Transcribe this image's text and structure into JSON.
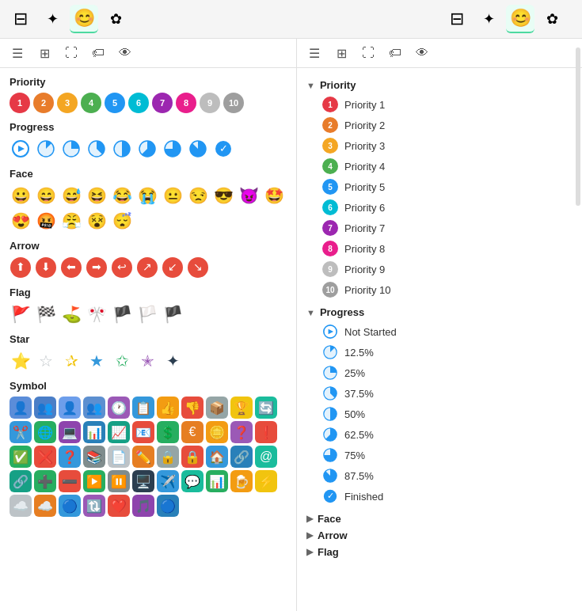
{
  "toolbar": {
    "icons": [
      {
        "name": "square-icon",
        "glyph": "⊟",
        "active": false
      },
      {
        "name": "sparkle-icon",
        "glyph": "✦",
        "active": false
      },
      {
        "name": "smiley-icon",
        "glyph": "😊",
        "active": true,
        "panel": "left"
      },
      {
        "name": "star-outline-icon",
        "glyph": "✿",
        "active": false
      },
      {
        "name": "square2-icon",
        "glyph": "⊟",
        "active": false
      },
      {
        "name": "sparkle2-icon",
        "glyph": "✦",
        "active": false
      },
      {
        "name": "smiley2-icon",
        "glyph": "😊",
        "active": true,
        "panel": "right"
      },
      {
        "name": "star-outline2-icon",
        "glyph": "✿",
        "active": false
      }
    ]
  },
  "left_subtoolbar": [
    "list",
    "grid",
    "expand",
    "tag",
    "eye"
  ],
  "right_subtoolbar": [
    "list",
    "grid",
    "expand",
    "tag",
    "eye"
  ],
  "priority": {
    "label": "Priority",
    "items": [
      {
        "num": 1,
        "color": "#e63946"
      },
      {
        "num": 2,
        "color": "#e87c2b"
      },
      {
        "num": 3,
        "color": "#f4a623"
      },
      {
        "num": 4,
        "color": "#4caf50"
      },
      {
        "num": 5,
        "color": "#2196f3"
      },
      {
        "num": 6,
        "color": "#00bcd4"
      },
      {
        "num": 7,
        "color": "#9c27b0"
      },
      {
        "num": 8,
        "color": "#e91e8c"
      },
      {
        "num": 9,
        "color": "#bdbdbd"
      },
      {
        "num": 10,
        "color": "#9e9e9e"
      }
    ]
  },
  "progress": {
    "label": "Progress",
    "items": [
      {
        "label": "Not Started",
        "type": "empty"
      },
      {
        "label": "12.5%",
        "type": "pie",
        "pct": 12.5
      },
      {
        "label": "25%",
        "type": "pie",
        "pct": 25
      },
      {
        "label": "37.5%",
        "type": "pie",
        "pct": 37.5
      },
      {
        "label": "50%",
        "type": "pie",
        "pct": 50
      },
      {
        "label": "62.5%",
        "type": "pie",
        "pct": 62.5
      },
      {
        "label": "75%",
        "type": "pie",
        "pct": 75
      },
      {
        "label": "87.5%",
        "type": "pie",
        "pct": 87.5
      },
      {
        "label": "Finished",
        "type": "check"
      }
    ]
  },
  "face": {
    "label": "Face",
    "glyphs": [
      "😀",
      "😄",
      "😅",
      "😆",
      "😂",
      "😭",
      "😐",
      "😒",
      "😎",
      "😈",
      "🤩",
      "😍",
      "🤬",
      "😤",
      "😵",
      "😴"
    ]
  },
  "arrow": {
    "label": "Arrow",
    "glyphs": [
      "⬆️",
      "⬇️",
      "⬅️",
      "➡️",
      "↩️",
      "↗️",
      "↙️",
      "↘️"
    ]
  },
  "flag": {
    "label": "Flag",
    "glyphs": [
      "🚩",
      "🏁",
      "⛳",
      "🎌",
      "🏴",
      "🏳️",
      "🏴‍☠️"
    ]
  },
  "star": {
    "label": "Star",
    "glyphs": [
      "⭐",
      "☆",
      "✰",
      "★",
      "✩",
      "✭",
      "✦"
    ]
  },
  "symbol": {
    "label": "Symbol",
    "items": [
      {
        "glyph": "👤",
        "bg": "#5b8dd9"
      },
      {
        "glyph": "👥",
        "bg": "#4a7ec7"
      },
      {
        "glyph": "👤",
        "bg": "#6d9eeb"
      },
      {
        "glyph": "👥",
        "bg": "#5c8fd0"
      },
      {
        "glyph": "🕐",
        "bg": "#9b59b6"
      },
      {
        "glyph": "📋",
        "bg": "#3498db"
      },
      {
        "glyph": "👍",
        "bg": "#f39c12"
      },
      {
        "glyph": "👎",
        "bg": "#e74c3c"
      },
      {
        "glyph": "📦",
        "bg": "#95a5a6"
      },
      {
        "glyph": "🏆",
        "bg": "#f1c40f"
      },
      {
        "glyph": "🔄",
        "bg": "#1abc9c"
      },
      {
        "glyph": "✂️",
        "bg": "#3498db"
      },
      {
        "glyph": "🌐",
        "bg": "#27ae60"
      },
      {
        "glyph": "💻",
        "bg": "#8e44ad"
      },
      {
        "glyph": "📊",
        "bg": "#2980b9"
      },
      {
        "glyph": "📈",
        "bg": "#16a085"
      },
      {
        "glyph": "📧",
        "bg": "#e74c3c"
      },
      {
        "glyph": "💲",
        "bg": "#27ae60"
      },
      {
        "glyph": "€",
        "bg": "#e67e22"
      },
      {
        "glyph": "🪙",
        "bg": "#f39c12"
      },
      {
        "glyph": "❓",
        "bg": "#9b59b6"
      },
      {
        "glyph": "❗",
        "bg": "#e74c3c"
      },
      {
        "glyph": "✅",
        "bg": "#27ae60"
      },
      {
        "glyph": "❌",
        "bg": "#e74c3c"
      },
      {
        "glyph": "❓",
        "bg": "#3498db"
      },
      {
        "glyph": "📚",
        "bg": "#7f8c8d"
      },
      {
        "glyph": "📄",
        "bg": "#bdc3c7"
      },
      {
        "glyph": "✏️",
        "bg": "#e67e22"
      },
      {
        "glyph": "🔒",
        "bg": "#95a5a6"
      },
      {
        "glyph": "🔒",
        "bg": "#e74c3c"
      },
      {
        "glyph": "🏠",
        "bg": "#3498db"
      },
      {
        "glyph": "🔗",
        "bg": "#2980b9"
      },
      {
        "glyph": "@",
        "bg": "#1abc9c"
      },
      {
        "glyph": "🔗",
        "bg": "#16a085"
      },
      {
        "glyph": "➕",
        "bg": "#27ae60"
      },
      {
        "glyph": "➖",
        "bg": "#e74c3c"
      },
      {
        "glyph": "▶️",
        "bg": "#27ae60"
      },
      {
        "glyph": "⏸️",
        "bg": "#7f8c8d"
      },
      {
        "glyph": "🖥️",
        "bg": "#2c3e50"
      },
      {
        "glyph": "✈️",
        "bg": "#3498db"
      },
      {
        "glyph": "💬",
        "bg": "#1abc9c"
      },
      {
        "glyph": "📊",
        "bg": "#27ae60"
      },
      {
        "glyph": "🍺",
        "bg": "#f39c12"
      },
      {
        "glyph": "⚡",
        "bg": "#f1c40f"
      },
      {
        "glyph": "☁️",
        "bg": "#bdc3c7"
      },
      {
        "glyph": "☁️",
        "bg": "#e67e22"
      },
      {
        "glyph": "🔵",
        "bg": "#3498db"
      },
      {
        "glyph": "🔃",
        "bg": "#9b59b6"
      },
      {
        "glyph": "❤️",
        "bg": "#e74c3c"
      },
      {
        "glyph": "🎵",
        "bg": "#8e44ad"
      },
      {
        "glyph": "🔵",
        "bg": "#2980b9"
      }
    ]
  },
  "right_panel": {
    "priority_label": "Priority",
    "priority_items": [
      {
        "num": 1,
        "label": "Priority 1",
        "color": "#e63946"
      },
      {
        "num": 2,
        "label": "Priority 2",
        "color": "#e87c2b"
      },
      {
        "num": 3,
        "label": "Priority 3",
        "color": "#f4a623"
      },
      {
        "num": 4,
        "label": "Priority 4",
        "color": "#4caf50"
      },
      {
        "num": 5,
        "label": "Priority 5",
        "color": "#2196f3"
      },
      {
        "num": 6,
        "label": "Priority 6",
        "color": "#00bcd4"
      },
      {
        "num": 7,
        "label": "Priority 7",
        "color": "#9c27b0"
      },
      {
        "num": 8,
        "label": "Priority 8",
        "color": "#e91e8c"
      },
      {
        "num": 9,
        "label": "Priority 9",
        "color": "#bdbdbd"
      },
      {
        "num": 10,
        "label": "Priority 10",
        "color": "#9e9e9e"
      }
    ],
    "progress_label": "Progress",
    "progress_items": [
      {
        "label": "Not Started",
        "type": "empty"
      },
      {
        "label": "12.5%",
        "type": "pie",
        "pct": 12.5
      },
      {
        "label": "25%",
        "type": "pie",
        "pct": 25
      },
      {
        "label": "37.5%",
        "type": "pie",
        "pct": 37.5
      },
      {
        "label": "50%",
        "type": "pie",
        "pct": 50
      },
      {
        "label": "62.5%",
        "type": "pie",
        "pct": 62.5
      },
      {
        "label": "75%",
        "type": "pie",
        "pct": 75
      },
      {
        "label": "87.5%",
        "type": "pie",
        "pct": 87.5
      },
      {
        "label": "Finished",
        "type": "check"
      }
    ],
    "face_label": "Face",
    "arrow_label": "Arrow",
    "flag_label": "Flag"
  }
}
